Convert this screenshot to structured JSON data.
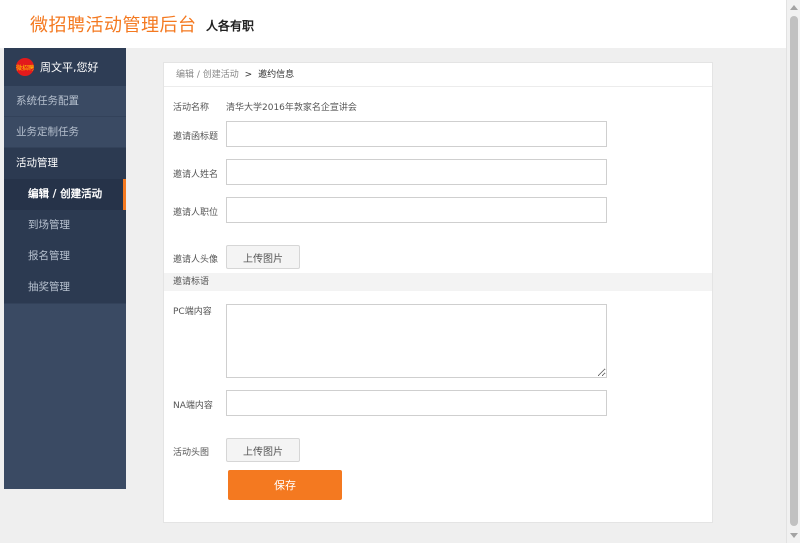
{
  "header": {
    "logo": "微招聘活动管理后台",
    "slogan": "人各有职"
  },
  "sidebar": {
    "avatar_text": "微招聘",
    "greeting": "周文平,您好",
    "items": [
      {
        "label": "系统任务配置"
      },
      {
        "label": "业务定制任务"
      }
    ],
    "group": {
      "label": "活动管理",
      "children": [
        {
          "label": "编辑 / 创建活动",
          "active": true
        },
        {
          "label": "到场管理"
        },
        {
          "label": "报名管理"
        },
        {
          "label": "抽奖管理"
        }
      ]
    }
  },
  "breadcrumb": {
    "parent": "编辑 / 创建活动",
    "separator": ">",
    "current": "邀约信息"
  },
  "form": {
    "activity_name_label": "活动名称",
    "activity_name_value": "清华大学2016年敦家名企宣讲会",
    "invite_title_label": "邀请函标题",
    "invite_title_value": "",
    "inviter_name_label": "邀请人姓名",
    "inviter_name_value": "",
    "inviter_position_label": "邀请人职位",
    "inviter_position_value": "",
    "inviter_avatar_label": "邀请人头像",
    "upload_label": "上传图片",
    "section_title": "邀请标语",
    "pc_content_label": "PC端内容",
    "pc_content_value": "",
    "na_content_label": "NA端内容",
    "na_content_value": "",
    "activity_image_label": "活动头图",
    "save_label": "保存"
  },
  "colors": {
    "accent": "#f47920",
    "sidebar_bg": "#3a4a63",
    "page_bg": "#efefef"
  }
}
